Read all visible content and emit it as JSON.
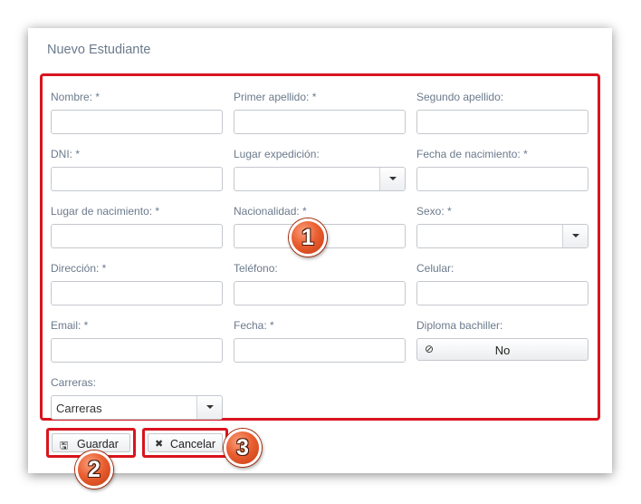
{
  "dialog": {
    "title": "Nuevo Estudiante"
  },
  "form": {
    "nombre": {
      "label": "Nombre:  *",
      "value": ""
    },
    "primer_apellido": {
      "label": "Primer apellido:  *",
      "value": ""
    },
    "segundo_apellido": {
      "label": "Segundo apellido:",
      "value": ""
    },
    "dni": {
      "label": "DNI:  *",
      "value": ""
    },
    "lugar_expedicion": {
      "label": "Lugar expedición:",
      "value": ""
    },
    "fecha_nacimiento": {
      "label": "Fecha de nacimiento:  *",
      "value": ""
    },
    "lugar_nacimiento": {
      "label": "Lugar de nacimiento:  *",
      "value": ""
    },
    "nacionalidad": {
      "label": "Nacionalidad:  *",
      "value": ""
    },
    "sexo": {
      "label": "Sexo:  *",
      "value": ""
    },
    "direccion": {
      "label": "Dirección:  *",
      "value": ""
    },
    "telefono": {
      "label": "Teléfono:",
      "value": ""
    },
    "celular": {
      "label": "Celular:",
      "value": ""
    },
    "email": {
      "label": "Email:  *",
      "value": ""
    },
    "fecha": {
      "label": "Fecha:  *",
      "value": ""
    },
    "diploma_bachiller": {
      "label": "Diploma bachiller:",
      "value": "No",
      "icon": "ban-icon"
    },
    "carreras": {
      "label": "Carreras:",
      "value": "Carreras"
    }
  },
  "actions": {
    "save": {
      "label": "Guardar",
      "icon": "floppy-disk-icon"
    },
    "cancel": {
      "label": "Cancelar",
      "icon": "close-icon"
    }
  },
  "badges": [
    "1",
    "2",
    "3"
  ],
  "colors": {
    "highlight": "#d9141e",
    "badge": "#ea5f31",
    "label": "#6b7a8c"
  }
}
